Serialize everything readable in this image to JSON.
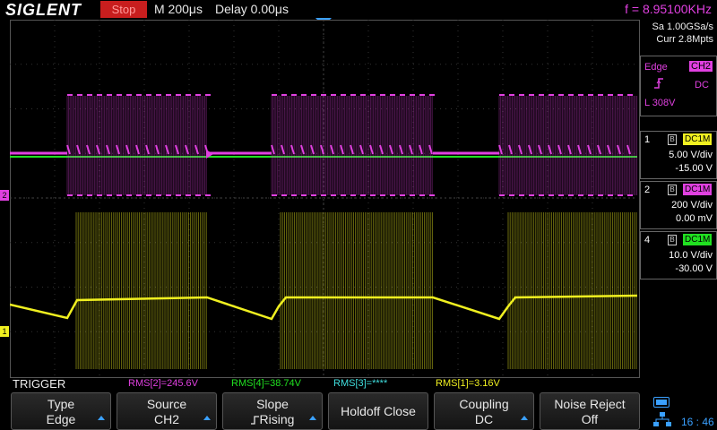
{
  "header": {
    "brand": "SIGLENT",
    "run_state": "Stop",
    "timebase": "M 200μs",
    "delay": "Delay 0.00μs",
    "frequency": "f = 8.95100KHz"
  },
  "acquisition": {
    "sample_rate": "Sa 1.00GSa/s",
    "memory": "Curr 2.8Mpts"
  },
  "trigger_panel": {
    "type": "Edge",
    "source": "CH2",
    "coupling": "DC",
    "level": "L  308V"
  },
  "channels": [
    {
      "num": "1",
      "coupling": "DC1M",
      "vdiv": "5.00 V/div",
      "offset": "-15.00 V",
      "color": "#f0f020"
    },
    {
      "num": "2",
      "coupling": "DC1M",
      "vdiv": "200 V/div",
      "offset": "0.00 mV",
      "color": "#e040e0"
    },
    {
      "num": "4",
      "coupling": "DC1M",
      "vdiv": "10.0 V/div",
      "offset": "-30.00 V",
      "color": "#20e020"
    }
  ],
  "measurements": {
    "section_label": "TRIGGER",
    "rms2": "RMS[2]=245.6V",
    "rms4": "RMS[4]=38.74V",
    "rms3": "RMS[3]=****",
    "rms1": "RMS[1]=3.16V"
  },
  "menu": [
    {
      "top": "Type",
      "bottom": "Edge"
    },
    {
      "top": "Source",
      "bottom": "CH2"
    },
    {
      "top": "Slope",
      "bottom": "Rising"
    },
    {
      "top": "Holdoff Close",
      "bottom": ""
    },
    {
      "top": "Coupling",
      "bottom": "DC"
    },
    {
      "top": "Noise Reject",
      "bottom": "Off"
    }
  ],
  "status": {
    "clock": "16 : 46"
  },
  "markers": {
    "ch2": "2",
    "ch1": "1"
  },
  "colors": {
    "ch1": "#f0f020",
    "ch2": "#e040e0",
    "ch4": "#20e020",
    "accent": "#3aa0ff",
    "run_state": "#c81e1e"
  }
}
